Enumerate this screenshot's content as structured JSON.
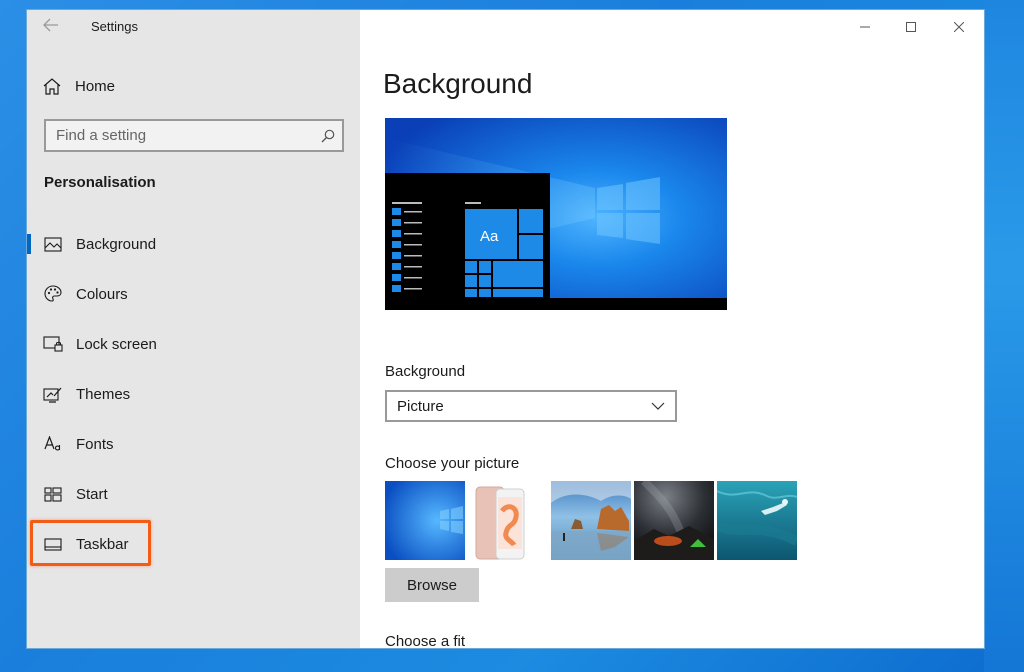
{
  "window": {
    "title": "Settings",
    "controls": [
      "minimize",
      "maximize",
      "close"
    ]
  },
  "sidebar": {
    "home_label": "Home",
    "search": {
      "placeholder": "Find a setting",
      "value": ""
    },
    "section_title": "Personalisation",
    "items": [
      {
        "label": "Background",
        "icon": "picture-icon",
        "selected": true
      },
      {
        "label": "Colours",
        "icon": "palette-icon",
        "selected": false
      },
      {
        "label": "Lock screen",
        "icon": "lock-screen-icon",
        "selected": false
      },
      {
        "label": "Themes",
        "icon": "themes-icon",
        "selected": false
      },
      {
        "label": "Fonts",
        "icon": "fonts-icon",
        "selected": false
      },
      {
        "label": "Start",
        "icon": "start-icon",
        "selected": false
      },
      {
        "label": "Taskbar",
        "icon": "taskbar-icon",
        "selected": false,
        "highlighted": true
      }
    ]
  },
  "main": {
    "title": "Background",
    "preview": {
      "tile_label": "Aa"
    },
    "background_field": {
      "label": "Background",
      "value": "Picture"
    },
    "choose_picture_label": "Choose your picture",
    "thumbnails": [
      "windows-blue",
      "iphone-rose-gold",
      "beach-rocks",
      "night-tent",
      "underwater-swimmer"
    ],
    "browse_label": "Browse",
    "choose_fit_label": "Choose a fit"
  },
  "colors": {
    "accent": "#0067c0",
    "highlight": "#f25c14",
    "sidebar_bg": "#e6e6e6"
  }
}
